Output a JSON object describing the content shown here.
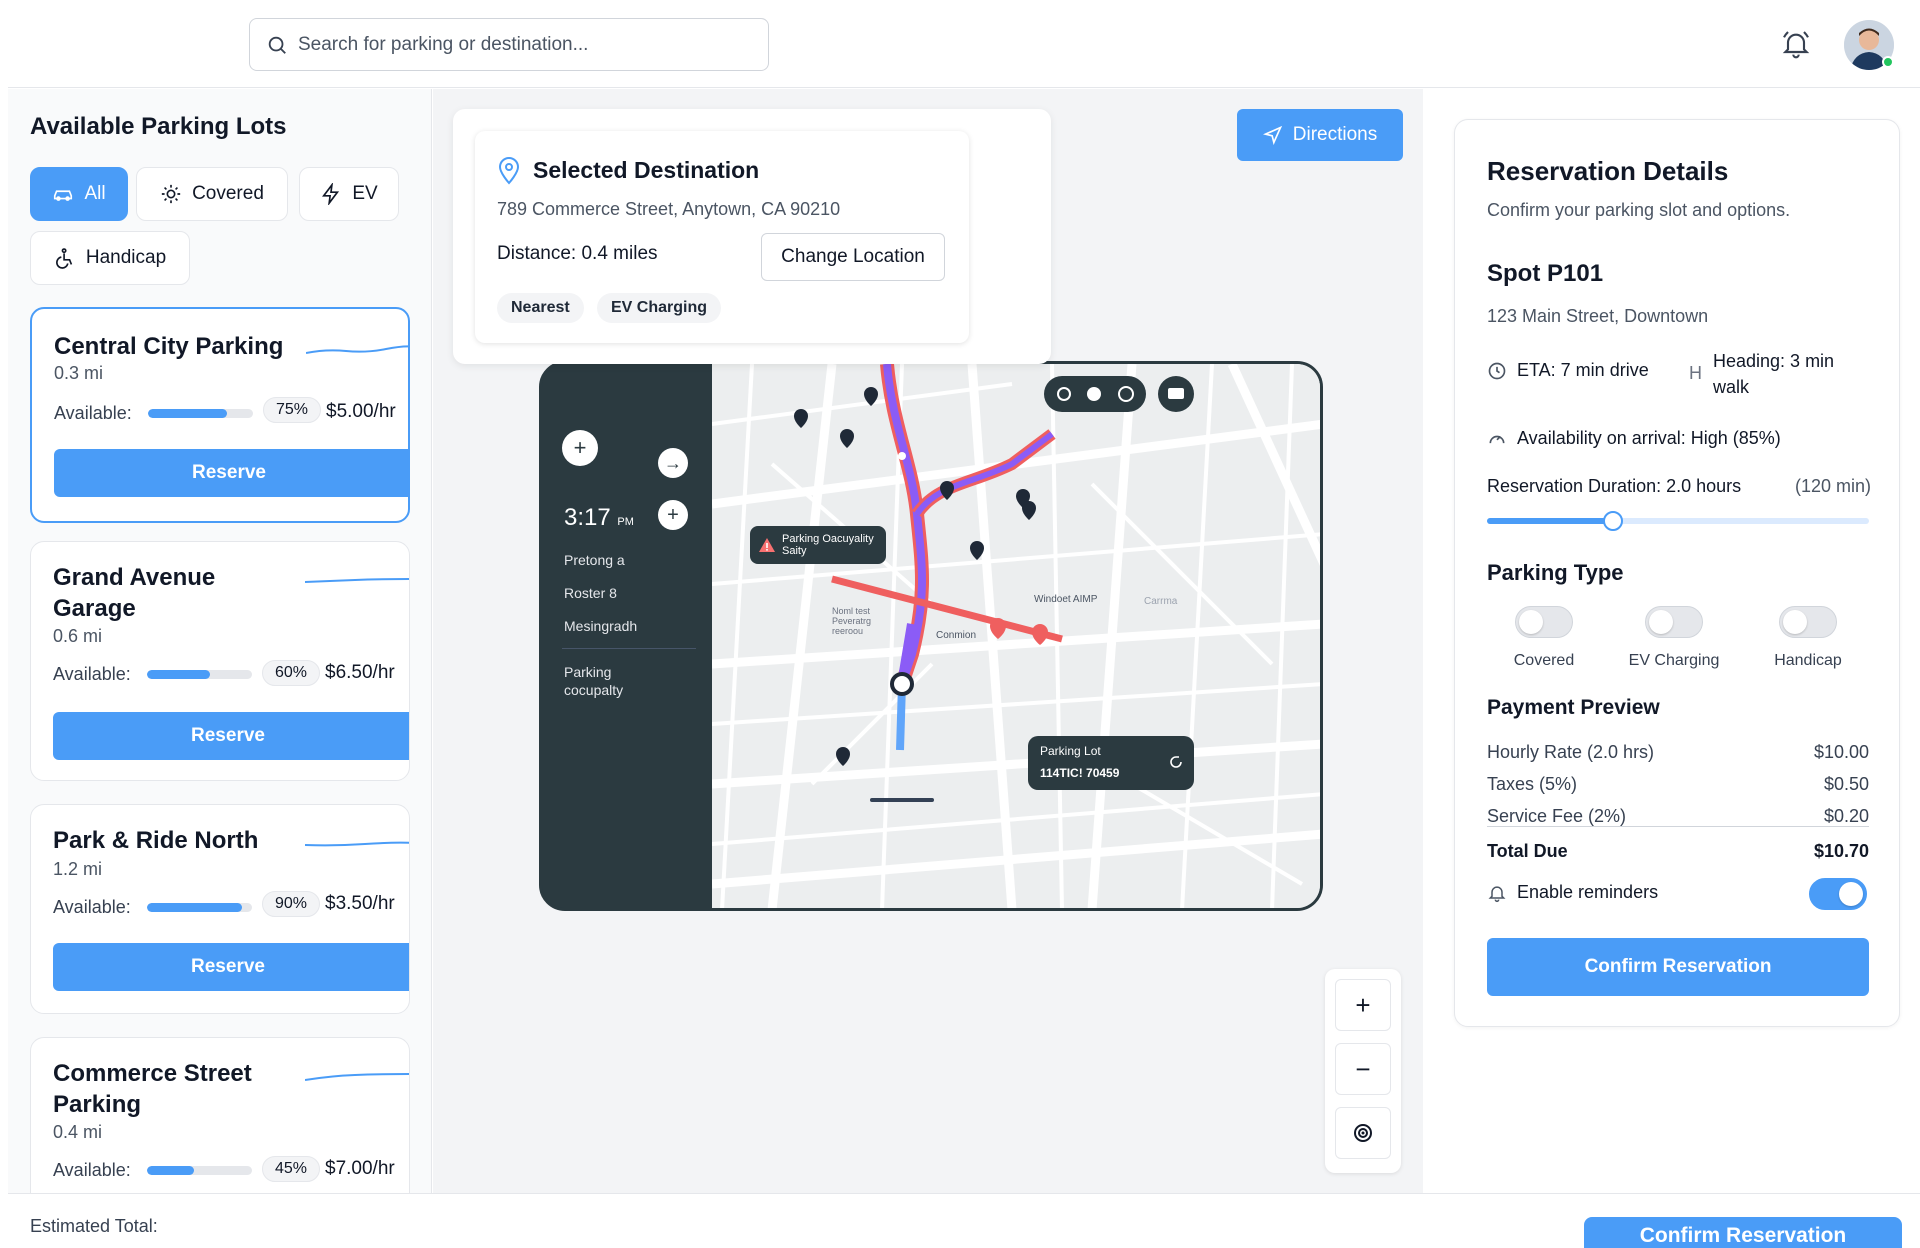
{
  "header": {
    "search_placeholder": "Search for parking or destination..."
  },
  "sidebar": {
    "title": "Available Parking Lots",
    "filters": [
      {
        "label": "All",
        "icon": "car-icon",
        "active": true
      },
      {
        "label": "Covered",
        "icon": "sun-icon",
        "active": false
      },
      {
        "label": "EV",
        "icon": "lightning-icon",
        "active": false
      },
      {
        "label": "Handicap",
        "icon": "accessibility-icon",
        "active": false
      }
    ],
    "available_label": "Available:",
    "reserve_label": "Reserve",
    "lots": [
      {
        "name": "Central City Parking",
        "distance": "0.3 mi",
        "availability_pct": 75,
        "availability": "75%",
        "price": "$5.00/hr"
      },
      {
        "name": "Grand Avenue Garage",
        "distance": "0.6 mi",
        "availability_pct": 60,
        "availability": "60%",
        "price": "$6.50/hr"
      },
      {
        "name": "Park & Ride North",
        "distance": "1.2 mi",
        "availability_pct": 90,
        "availability": "90%",
        "price": "$3.50/hr"
      },
      {
        "name": "Commerce Street Parking",
        "distance": "0.4 mi",
        "availability_pct": 45,
        "availability": "45%",
        "price": "$7.00/hr"
      }
    ]
  },
  "destination": {
    "title": "Selected Destination",
    "address": "789 Commerce Street, Anytown, CA 90210",
    "distance": "Distance: 0.4 miles",
    "change_label": "Change Location",
    "tags": [
      "Nearest",
      "EV Charging"
    ]
  },
  "map": {
    "directions_label": "Directions",
    "panel_time": "3:17",
    "panel_ampm": "PM",
    "panel_lines": [
      "Pretong a",
      "Roster 8",
      "Mesingradh"
    ],
    "panel_footer": [
      "Parking",
      "cocupalty"
    ],
    "alert_text": [
      "Parking Oacuyality",
      "Saity"
    ],
    "street_labels": [
      "Windoet AIMP",
      "Conmion",
      "Carrma",
      "Noml test",
      "Peveratrg",
      "reeroou"
    ],
    "lot_card_title": "Parking Lot",
    "lot_card_code": "114TIC! 70459"
  },
  "reservation": {
    "title": "Reservation Details",
    "subtitle": "Confirm your parking slot and options.",
    "spot": "Spot P101",
    "spot_address": "123 Main Street, Downtown",
    "eta": "ETA: 7 min drive",
    "heading": "Heading: 3 min walk",
    "availability": "Availability on arrival: High (85%)",
    "duration_label": "Reservation Duration: 2.0 hours",
    "duration_min": "(120 min)",
    "duration_fraction": 0.33,
    "parking_type_title": "Parking Type",
    "parking_types": [
      {
        "label": "Covered",
        "on": false
      },
      {
        "label": "EV Charging",
        "on": false
      },
      {
        "label": "Handicap",
        "on": false
      }
    ],
    "payment_title": "Payment Preview",
    "payment_rows": [
      {
        "label": "Hourly Rate (2.0 hrs)",
        "value": "$10.00"
      },
      {
        "label": "Taxes (5%)",
        "value": "$0.50"
      },
      {
        "label": "Service Fee (2%)",
        "value": "$0.20"
      }
    ],
    "total_label": "Total Due",
    "total_value": "$10.70",
    "reminders_label": "Enable reminders",
    "reminders_on": true,
    "confirm_label": "Confirm Reservation"
  },
  "footer": {
    "estimated_label": "Estimated Total:",
    "confirm_label": "Confirm Reservation"
  },
  "colors": {
    "accent": "#4a9cf7",
    "route_purple": "#8b5cf6",
    "route_red": "#ef5f5f",
    "device_dark": "#2b3a40"
  }
}
